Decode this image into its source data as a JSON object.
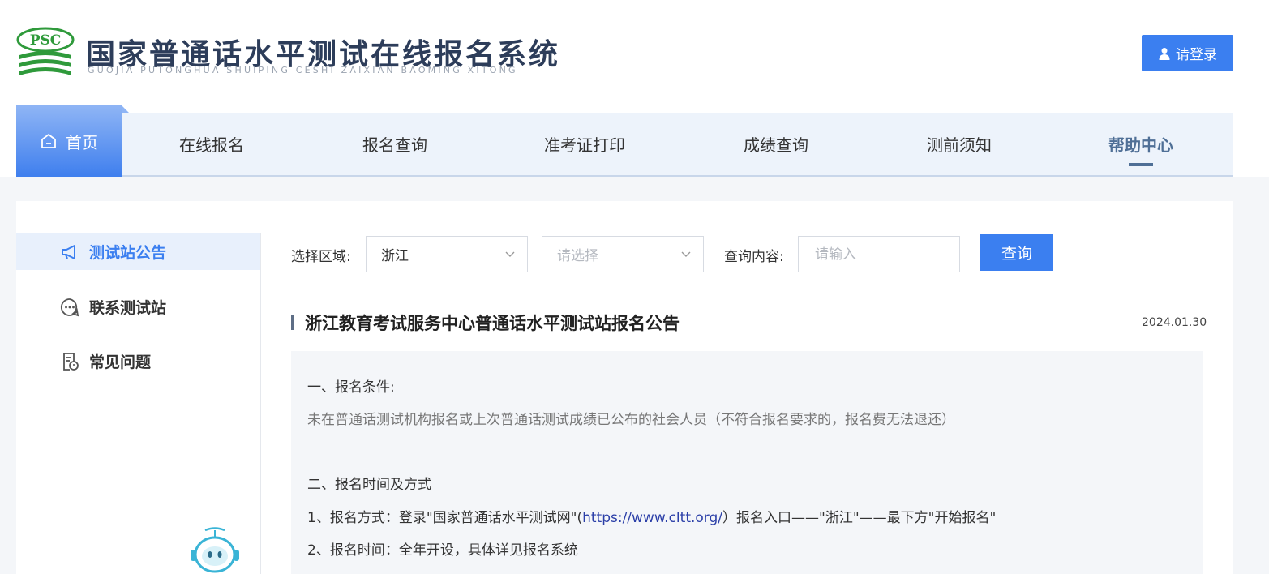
{
  "header": {
    "logo_text": "PSC",
    "title": "国家普通话水平测试在线报名系统",
    "subtitle": "GUOJIA PUTONGHUA SHUIPING CESHI ZAIXIAN BAOMING XITONG",
    "login_label": "请登录",
    "login_icon": "user-icon"
  },
  "nav": {
    "home_label": "首页",
    "home_icon": "home-icon",
    "items": [
      {
        "label": "在线报名"
      },
      {
        "label": "报名查询"
      },
      {
        "label": "准考证打印"
      },
      {
        "label": "成绩查询"
      },
      {
        "label": "测前须知"
      },
      {
        "label": "帮助中心"
      }
    ],
    "active": "帮助中心"
  },
  "sidebar": {
    "items": [
      {
        "label": "测试站公告",
        "icon": "megaphone-icon",
        "active": true
      },
      {
        "label": "联系测试站",
        "icon": "chat-icon",
        "active": false
      },
      {
        "label": "常见问题",
        "icon": "faq-icon",
        "active": false
      }
    ]
  },
  "search": {
    "region_label": "选择区域:",
    "region_value": "浙江",
    "sub_region_placeholder": "请选择",
    "content_label": "查询内容:",
    "content_placeholder": "请输入",
    "button_label": "查询"
  },
  "notice": {
    "title": "浙江教育考试服务中心普通话水平测试站报名公告",
    "date": "2024.01.30",
    "line1": "一、报名条件:",
    "line2": "未在普通话测试机构报名或上次普通话测试成绩已公布的社会人员（不符合报名要求的，报名费无法退还）",
    "line3": "二、报名时间及方式",
    "line4_prefix": "1、报名方式：登录\"国家普通话水平测试网\"(",
    "line4_link": "https://www.cltt.org/",
    "line4_suffix": "）报名入口——\"浙江\"——最下方\"开始报名\"",
    "line5": "2、报名时间：全年开设，具体详见报名系统"
  },
  "colors": {
    "accent": "#3b7ff0",
    "nav_bg": "#edf3fb",
    "active_nav": "#4f6f96",
    "logo_green": "#2f9a3b"
  }
}
